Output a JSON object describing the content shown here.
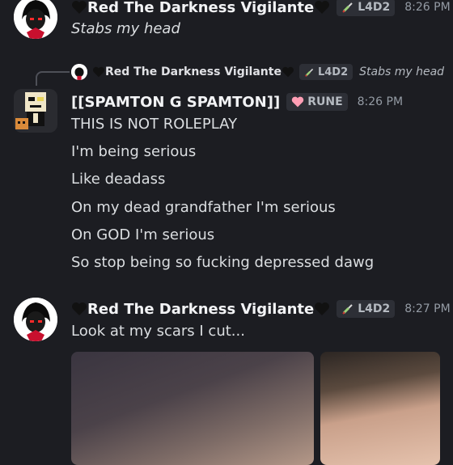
{
  "messages": [
    {
      "author": "Red The Darkness Vigilante",
      "tag": "L4D2",
      "time": "8:26 PM",
      "lines": [
        "Stabs my head"
      ]
    },
    {
      "reply": {
        "author": "Red The Darkness Vigilante",
        "tag": "L4D2",
        "text": "Stabs my head"
      },
      "author": "[[SPAMTON G SPAMTON]]",
      "tag": "RUNE",
      "time": "8:26 PM",
      "lines": [
        "THIS IS NOT ROLEPLAY",
        "I'm being serious",
        "Like deadass",
        "On my dead grandfather I'm serious",
        "On GOD I'm serious",
        "So stop being so fucking depressed dawg"
      ]
    },
    {
      "author": "Red The Darkness Vigilante",
      "tag": "L4D2",
      "time": "8:27 PM",
      "lines": [
        "Look at my scars I cut..."
      ]
    }
  ],
  "icons": {
    "heart": "black-heart-icon",
    "l4d2_badge": "syringe-icon",
    "rune_badge": "pink-heart-icon"
  },
  "colors": {
    "background": "#1c1d22",
    "text": "#dbdee1",
    "muted": "#949ba4",
    "tag_bg": "#2d2f36"
  }
}
